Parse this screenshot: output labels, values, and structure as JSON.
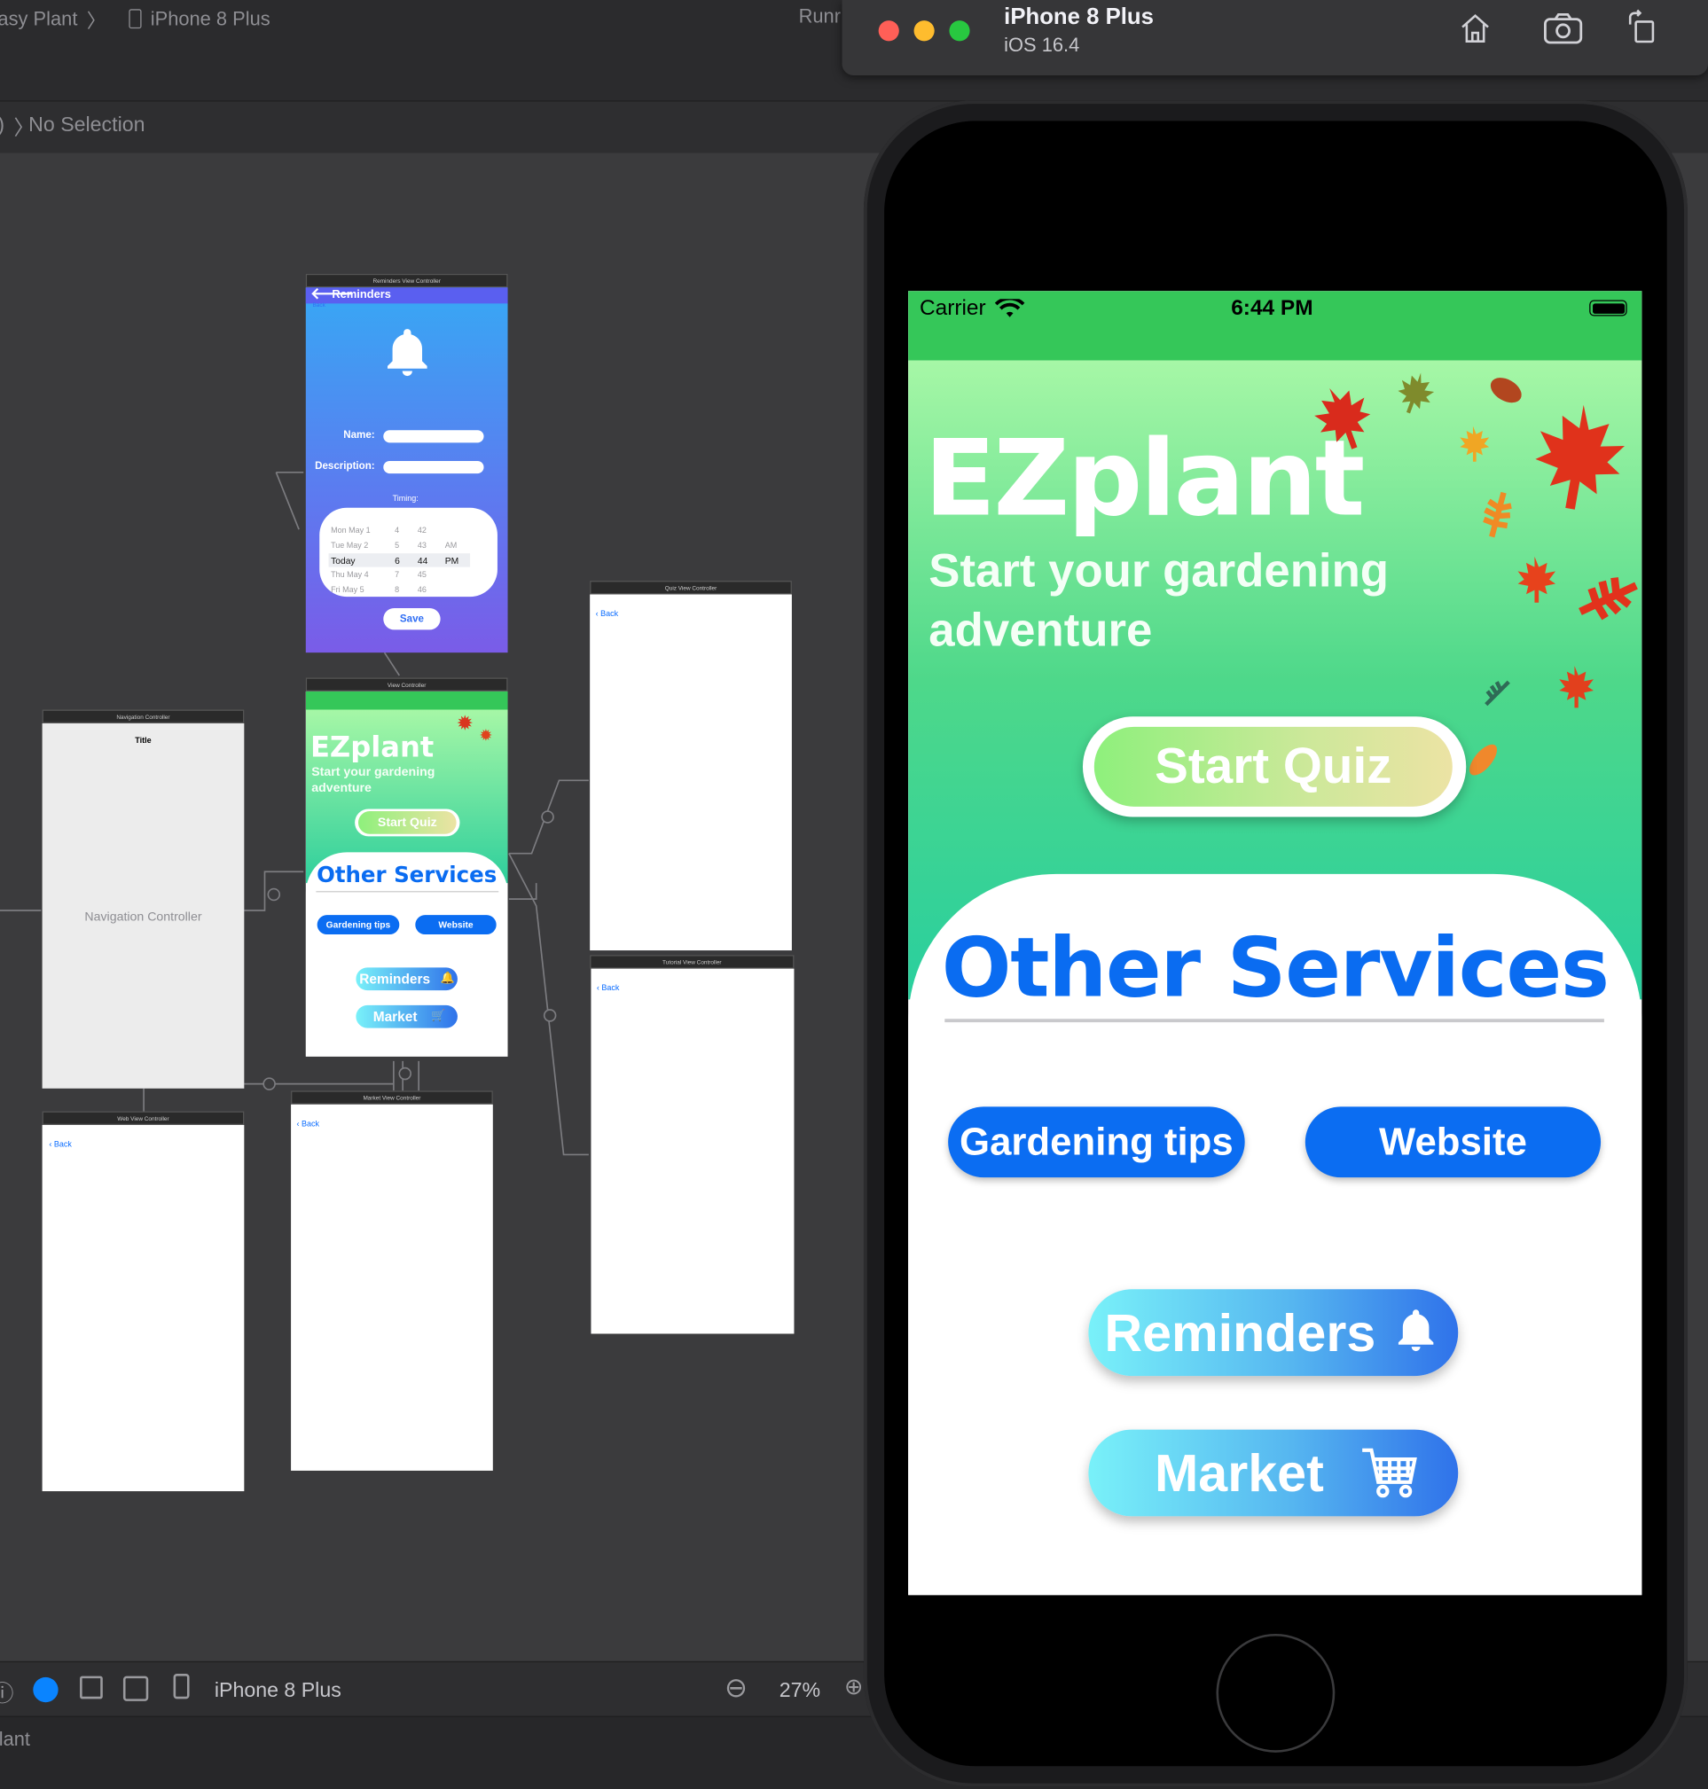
{
  "xcode": {
    "breadcrumb_project": "asy Plant",
    "breadcrumb_device": "iPhone 8 Plus",
    "run_status": "Runr",
    "jump_bar": "No Selection",
    "bottom_device": "iPhone 8 Plus",
    "zoom": "27%",
    "status_name": "lant"
  },
  "storyboard": {
    "reminders_vc": "Reminders View Controller",
    "reminders_nav": "Reminders",
    "reminders_back": "Back",
    "name_label": "Name:",
    "desc_label": "Description:",
    "timing_label": "Timing:",
    "save_label": "Save",
    "picker_rows": [
      {
        "d": "Mon May 1",
        "h": "4",
        "m": "42",
        "p": ""
      },
      {
        "d": "Tue May 2",
        "h": "5",
        "m": "43",
        "p": "AM"
      },
      {
        "d": "Today",
        "h": "6",
        "m": "44",
        "p": "PM"
      },
      {
        "d": "Thu May 4",
        "h": "7",
        "m": "45",
        "p": ""
      },
      {
        "d": "Fri May 5",
        "h": "8",
        "m": "46",
        "p": ""
      }
    ],
    "view_controller": "View Controller",
    "mini_title": "EZplant",
    "mini_tagline": "Start your gardening adventure",
    "mini_quiz": "Start Quiz",
    "mini_services": "Other Services",
    "mini_tips": "Gardening tips",
    "mini_website": "Website",
    "mini_reminders": "Reminders",
    "mini_market": "Market",
    "nav_controller_bar": "Navigation Controller",
    "nav_title": "Title",
    "nav_controller_label": "Navigation Controller",
    "web_vc": "Web View Controller",
    "market_vc": "Market View Controller",
    "quiz_vc": "Quiz View Controller",
    "tutorial_vc": "Tutorial View Controller",
    "back": "Back"
  },
  "simulator": {
    "device_name": "iPhone 8 Plus",
    "os_version": "iOS 16.4"
  },
  "app": {
    "carrier": "Carrier",
    "time": "6:44 PM",
    "title": "EZplant",
    "tagline": "Start your gardening adventure",
    "quiz_button": "Start Quiz",
    "services_title": "Other Services",
    "tips_button": "Gardening tips",
    "website_button": "Website",
    "reminders_button": "Reminders",
    "market_button": "Market",
    "colors": {
      "status_green": "#35c759",
      "accent_blue": "#0b6df2"
    }
  }
}
